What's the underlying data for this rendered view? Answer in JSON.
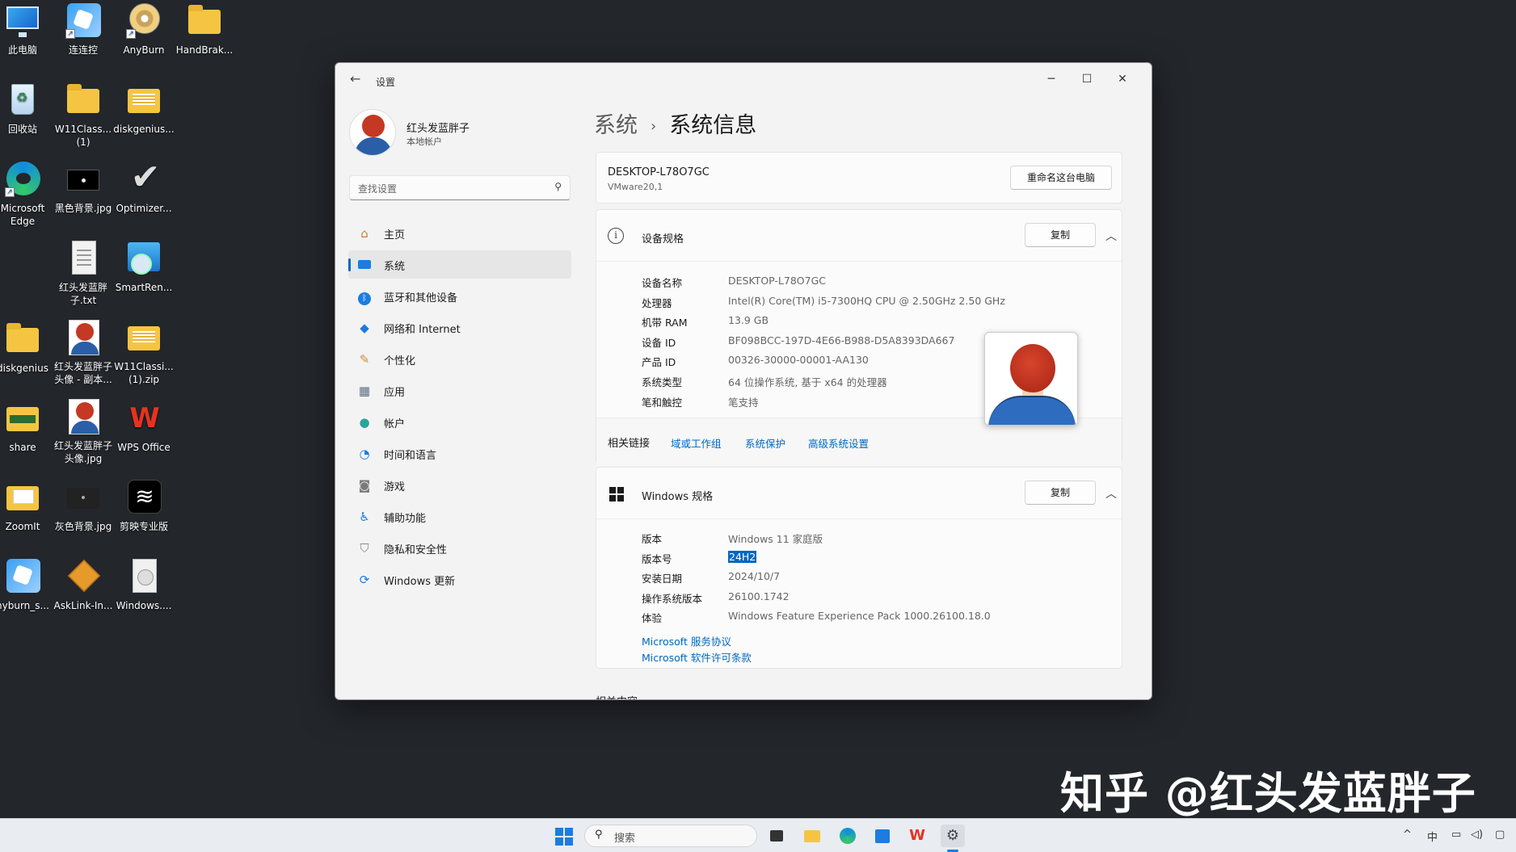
{
  "desktop": {
    "icons": [
      {
        "label": "此电脑",
        "icon": "this-pc-icon"
      },
      {
        "label": "连连控",
        "icon": "remote-control-icon"
      },
      {
        "label": "AnyBurn",
        "icon": "disc-icon"
      },
      {
        "label": "HandBrak...",
        "icon": "folder-icon"
      },
      {
        "label": "回收站",
        "icon": "recycle-bin-icon"
      },
      {
        "label": "W11Class...\n(1)",
        "icon": "folder-icon"
      },
      {
        "label": "diskgenius...",
        "icon": "zip-icon"
      },
      {
        "label": "Microsoft\nEdge",
        "icon": "edge-icon"
      },
      {
        "label": "黑色背景.jpg",
        "icon": "image-icon"
      },
      {
        "label": "Optimizer...",
        "icon": "check-icon"
      },
      {
        "label": "红头发蓝胖\n子.txt",
        "icon": "text-file-icon"
      },
      {
        "label": "SmartRen...",
        "icon": "smartren-icon"
      },
      {
        "label": "diskgenius",
        "icon": "folder-icon"
      },
      {
        "label": "红头发蓝胖子\n头像 - 副本...",
        "icon": "avatar-image-icon"
      },
      {
        "label": "W11Classi...\n(1).zip",
        "icon": "zip-icon"
      },
      {
        "label": "share",
        "icon": "folder-icon"
      },
      {
        "label": "红头发蓝胖子\n头像.jpg",
        "icon": "avatar-image-icon"
      },
      {
        "label": "WPS Office",
        "icon": "wps-icon"
      },
      {
        "label": "ZoomIt",
        "icon": "folder-icon"
      },
      {
        "label": "灰色背景.jpg",
        "icon": "image-icon"
      },
      {
        "label": "剪映专业版",
        "icon": "capcut-icon"
      },
      {
        "label": "nyburn_s...",
        "icon": "installer-icon"
      },
      {
        "label": "AskLink-In...",
        "icon": "package-icon"
      },
      {
        "label": "Windows....",
        "icon": "file-icon"
      }
    ]
  },
  "window": {
    "title": "设置",
    "back": "←",
    "minimize": "─",
    "maximize": "☐",
    "close": "✕"
  },
  "user": {
    "name": "红头发蓝胖子",
    "account_type": "本地帐户"
  },
  "search": {
    "placeholder": "查找设置"
  },
  "nav": {
    "items": [
      {
        "label": "主页",
        "icon": "home-icon",
        "active": false
      },
      {
        "label": "系统",
        "icon": "system-icon",
        "active": true
      },
      {
        "label": "蓝牙和其他设备",
        "icon": "bluetooth-icon",
        "active": false
      },
      {
        "label": "网络和 Internet",
        "icon": "network-icon",
        "active": false
      },
      {
        "label": "个性化",
        "icon": "brush-icon",
        "active": false
      },
      {
        "label": "应用",
        "icon": "apps-icon",
        "active": false
      },
      {
        "label": "帐户",
        "icon": "account-icon",
        "active": false
      },
      {
        "label": "时间和语言",
        "icon": "time-language-icon",
        "active": false
      },
      {
        "label": "游戏",
        "icon": "gaming-icon",
        "active": false
      },
      {
        "label": "辅助功能",
        "icon": "accessibility-icon",
        "active": false
      },
      {
        "label": "隐私和安全性",
        "icon": "privacy-shield-icon",
        "active": false
      },
      {
        "label": "Windows 更新",
        "icon": "windows-update-icon",
        "active": false
      }
    ]
  },
  "breadcrumb": {
    "parent": "系统",
    "separator": "›",
    "current": "系统信息"
  },
  "pc": {
    "name": "DESKTOP-L78O7GC",
    "model": "VMware20,1",
    "rename_button": "重命名这台电脑"
  },
  "device_specs": {
    "title": "设备规格",
    "copy_button": "复制",
    "rows": [
      {
        "key": "设备名称",
        "value": "DESKTOP-L78O7GC"
      },
      {
        "key": "处理器",
        "value": "Intel(R) Core(TM) i5-7300HQ CPU @ 2.50GHz   2.50 GHz"
      },
      {
        "key": "机带 RAM",
        "value": "13.9 GB"
      },
      {
        "key": "设备 ID",
        "value": "BF098BCC-197D-4E66-B988-D5A8393DA667"
      },
      {
        "key": "产品 ID",
        "value": "00326-30000-00001-AA130"
      },
      {
        "key": "系统类型",
        "value": "64 位操作系统, 基于 x64 的处理器"
      },
      {
        "key": "笔和触控",
        "value": "笔支持"
      }
    ]
  },
  "related_links": {
    "label": "相关链接",
    "links": [
      "域或工作组",
      "系统保护",
      "高级系统设置"
    ]
  },
  "windows_specs": {
    "title": "Windows 规格",
    "copy_button": "复制",
    "rows": [
      {
        "key": "版本",
        "value": "Windows 11 家庭版"
      },
      {
        "key": "版本号",
        "value": "24H2"
      },
      {
        "key": "安装日期",
        "value": "2024/10/7"
      },
      {
        "key": "操作系统版本",
        "value": "26100.1742"
      },
      {
        "key": "体验",
        "value": "Windows Feature Experience Pack 1000.26100.18.0"
      }
    ],
    "links": [
      "Microsoft 服务协议",
      "Microsoft 软件许可条款"
    ]
  },
  "cut_off_section": "相关内容",
  "watermark": "知乎 @红头发蓝胖子",
  "taskbar": {
    "search_placeholder": "搜索",
    "tray": {
      "chevron": "^",
      "ime": "中"
    }
  },
  "colors": {
    "accent": "#0067c0",
    "desktop_bg": "#23262b",
    "window_bg": "#f3f3f3",
    "card_bg": "#fbfbfb"
  }
}
